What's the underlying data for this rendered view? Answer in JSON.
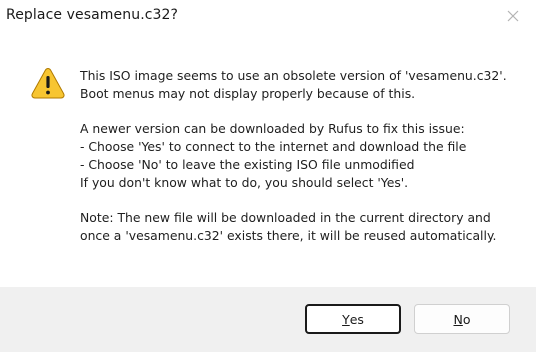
{
  "dialog": {
    "title": "Replace vesamenu.c32?",
    "icon": "warning-icon",
    "message_lines": [
      "This ISO image seems to use an obsolete version of 'vesamenu.c32'.",
      "Boot menus may not display properly because of this.",
      "",
      "A newer version can be downloaded by Rufus to fix this issue:",
      "- Choose 'Yes' to connect to the internet and download the file",
      "- Choose 'No' to leave the existing ISO file unmodified",
      "If you don't know what to do, you should select 'Yes'.",
      "",
      "Note: The new file will be downloaded in the current directory and",
      "once a 'vesamenu.c32' exists there, it will be reused automatically."
    ]
  },
  "buttons": {
    "yes": {
      "mnemonic": "Y",
      "rest": "es"
    },
    "no": {
      "mnemonic": "N",
      "rest": "o"
    }
  },
  "colors": {
    "warning_fill": "#f7c531",
    "warning_outline": "#b07a00",
    "footer_bg": "#f0f0f0",
    "default_button_border": "#1a1a1a"
  }
}
